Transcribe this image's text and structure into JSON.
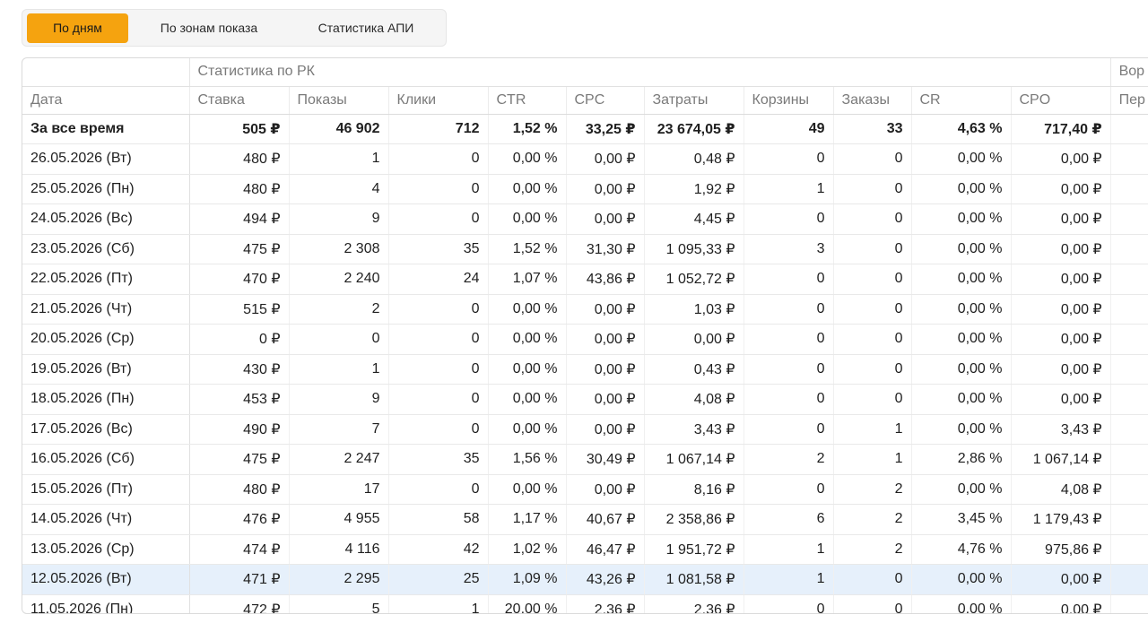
{
  "tabs": [
    {
      "label": "По дням",
      "active": true
    },
    {
      "label": "По зонам показа",
      "active": false
    },
    {
      "label": "Статистика АПИ",
      "active": false
    }
  ],
  "table": {
    "group_headers": {
      "main": "Статистика по РК",
      "next": "Вор"
    },
    "columns": [
      "Дата",
      "Ставка",
      "Показы",
      "Клики",
      "CTR",
      "CPC",
      "Затраты",
      "Корзины",
      "Заказы",
      "CR",
      "CPO",
      "Пер"
    ],
    "rows": [
      [
        "За все время",
        "505 ₽",
        "46 902",
        "712",
        "1,52 %",
        "33,25 ₽",
        "23 674,05 ₽",
        "49",
        "33",
        "4,63 %",
        "717,40 ₽"
      ],
      [
        "26.05.2026 (Вт)",
        "480 ₽",
        "1",
        "0",
        "0,00 %",
        "0,00 ₽",
        "0,48 ₽",
        "0",
        "0",
        "0,00 %",
        "0,00 ₽"
      ],
      [
        "25.05.2026 (Пн)",
        "480 ₽",
        "4",
        "0",
        "0,00 %",
        "0,00 ₽",
        "1,92 ₽",
        "1",
        "0",
        "0,00 %",
        "0,00 ₽"
      ],
      [
        "24.05.2026 (Вс)",
        "494 ₽",
        "9",
        "0",
        "0,00 %",
        "0,00 ₽",
        "4,45 ₽",
        "0",
        "0",
        "0,00 %",
        "0,00 ₽"
      ],
      [
        "23.05.2026 (Сб)",
        "475 ₽",
        "2 308",
        "35",
        "1,52 %",
        "31,30 ₽",
        "1 095,33 ₽",
        "3",
        "0",
        "0,00 %",
        "0,00 ₽"
      ],
      [
        "22.05.2026 (Пт)",
        "470 ₽",
        "2 240",
        "24",
        "1,07 %",
        "43,86 ₽",
        "1 052,72 ₽",
        "0",
        "0",
        "0,00 %",
        "0,00 ₽"
      ],
      [
        "21.05.2026 (Чт)",
        "515 ₽",
        "2",
        "0",
        "0,00 %",
        "0,00 ₽",
        "1,03 ₽",
        "0",
        "0",
        "0,00 %",
        "0,00 ₽"
      ],
      [
        "20.05.2026 (Ср)",
        "0 ₽",
        "0",
        "0",
        "0,00 %",
        "0,00 ₽",
        "0,00 ₽",
        "0",
        "0",
        "0,00 %",
        "0,00 ₽"
      ],
      [
        "19.05.2026 (Вт)",
        "430 ₽",
        "1",
        "0",
        "0,00 %",
        "0,00 ₽",
        "0,43 ₽",
        "0",
        "0",
        "0,00 %",
        "0,00 ₽"
      ],
      [
        "18.05.2026 (Пн)",
        "453 ₽",
        "9",
        "0",
        "0,00 %",
        "0,00 ₽",
        "4,08 ₽",
        "0",
        "0",
        "0,00 %",
        "0,00 ₽"
      ],
      [
        "17.05.2026 (Вс)",
        "490 ₽",
        "7",
        "0",
        "0,00 %",
        "0,00 ₽",
        "3,43 ₽",
        "0",
        "1",
        "0,00 %",
        "3,43 ₽"
      ],
      [
        "16.05.2026 (Сб)",
        "475 ₽",
        "2 247",
        "35",
        "1,56 %",
        "30,49 ₽",
        "1 067,14 ₽",
        "2",
        "1",
        "2,86 %",
        "1 067,14 ₽"
      ],
      [
        "15.05.2026 (Пт)",
        "480 ₽",
        "17",
        "0",
        "0,00 %",
        "0,00 ₽",
        "8,16 ₽",
        "0",
        "2",
        "0,00 %",
        "4,08 ₽"
      ],
      [
        "14.05.2026 (Чт)",
        "476 ₽",
        "4 955",
        "58",
        "1,17 %",
        "40,67 ₽",
        "2 358,86 ₽",
        "6",
        "2",
        "3,45 %",
        "1 179,43 ₽"
      ],
      [
        "13.05.2026 (Ср)",
        "474 ₽",
        "4 116",
        "42",
        "1,02 %",
        "46,47 ₽",
        "1 951,72 ₽",
        "1",
        "2",
        "4,76 %",
        "975,86 ₽"
      ],
      [
        "12.05.2026 (Вт)",
        "471 ₽",
        "2 295",
        "25",
        "1,09 %",
        "43,26 ₽",
        "1 081,58 ₽",
        "1",
        "0",
        "0,00 %",
        "0,00 ₽"
      ],
      [
        "11.05.2026 (Пн)",
        "472 ₽",
        "5",
        "1",
        "20,00 %",
        "2,36 ₽",
        "2,36 ₽",
        "0",
        "0",
        "0,00 %",
        "0,00 ₽"
      ]
    ]
  },
  "colors": {
    "accent": "#f5a30f",
    "row_highlight": "#e6f0fb"
  }
}
